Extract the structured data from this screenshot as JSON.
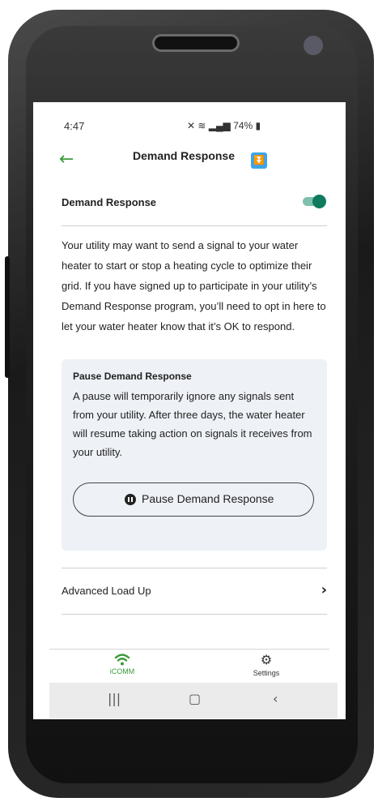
{
  "status": {
    "time": "4:47",
    "battery": "74%"
  },
  "appbar": {
    "title": "Demand Response",
    "back_icon": "arrow-left-icon",
    "title_icon": "double-down-arrow-icon"
  },
  "demand_response": {
    "label": "Demand Response",
    "enabled": true,
    "description": "Your utility may want to send a signal to your water heater to start or stop a heating cycle to optimize their grid. If you have signed up to participate in your utility’s Demand Response program, you’ll need to opt in here to let your water heater know that it’s OK to respond."
  },
  "pause_card": {
    "title": "Pause Demand Response",
    "body": "A pause will temporarily ignore any signals sent from your utility. After three days, the water heater will resume taking action on signals it receives from your utility.",
    "button_label": "Pause Demand Response"
  },
  "advanced": {
    "label": "Advanced Load Up"
  },
  "bottom_nav": {
    "icomm": "iCOMM",
    "settings": "Settings"
  },
  "colors": {
    "accent": "#3a9b3a",
    "toggle": "#0f7a5e",
    "card_bg": "#eef1f6"
  }
}
